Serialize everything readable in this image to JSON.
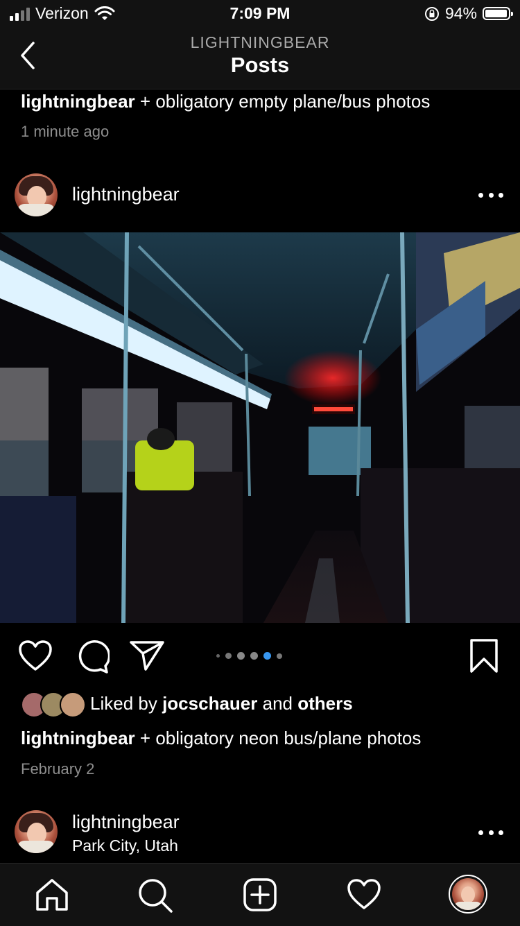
{
  "status_bar": {
    "carrier": "Verizon",
    "time": "7:09 PM",
    "battery_percent": "94%",
    "battery_level": 0.94
  },
  "header": {
    "subtitle": "LIGHTNINGBEAR",
    "title": "Posts"
  },
  "previous_post": {
    "username": "lightningbear",
    "caption": "+ obligatory empty plane/bus photos",
    "timestamp": "1 minute ago"
  },
  "post": {
    "username": "lightningbear",
    "more_icon": "more-horizontal-icon",
    "image_description_icon": "bus-interior-photo",
    "carousel": {
      "count": 5,
      "active_index": 3
    },
    "likes_prefix": "Liked by",
    "liked_by": "jocschauer",
    "likes_connector": "and",
    "likes_suffix": "others",
    "caption_username": "lightningbear",
    "caption": "+ obligatory neon bus/plane photos",
    "date": "February 2"
  },
  "next_post": {
    "username": "lightningbear",
    "location": "Park City, Utah"
  },
  "colors": {
    "background": "#000000",
    "bar_background": "#121212",
    "accent_blue": "#3897f0",
    "muted_text": "#8e8e8e"
  },
  "tab_bar": {
    "icons": [
      "home-icon",
      "search-icon",
      "new-post-icon",
      "activity-heart-icon",
      "profile-avatar"
    ]
  }
}
